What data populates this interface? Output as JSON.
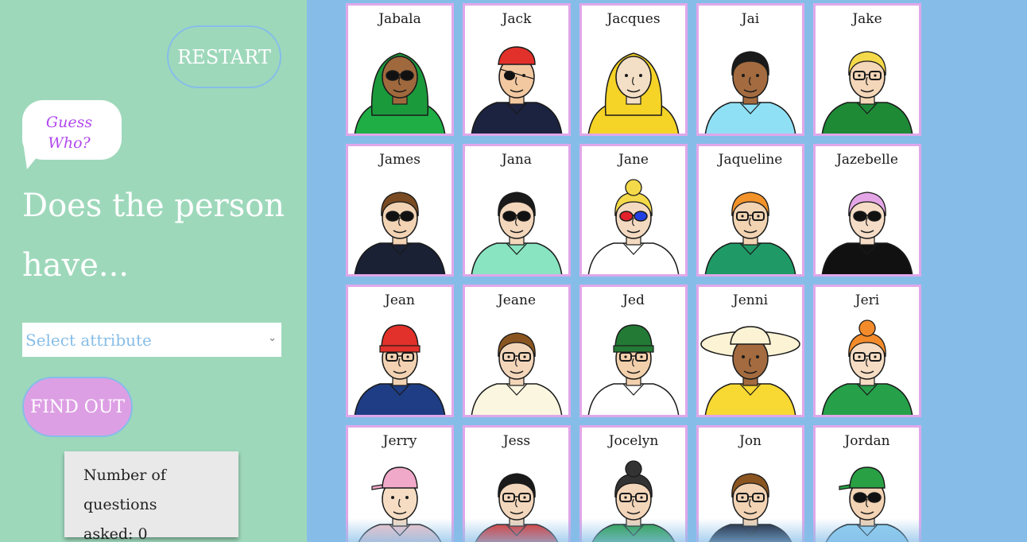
{
  "sidebar": {
    "restart_label": "RESTART",
    "bubble_line1": "Guess",
    "bubble_line2": "Who?",
    "question_line1": "Does the person",
    "question_line2": "have...",
    "select_placeholder": "Select attribute",
    "find_out_label": "FIND OUT",
    "counter_line1": "Number of questions",
    "counter_line2": "asked: 0"
  },
  "colors": {
    "sidebar_bg": "#9ed8bb",
    "board_bg": "#86bde8",
    "card_border": "#e0a7ea",
    "find_out_bg": "#dd9fe4",
    "bubble_text": "#b249f0"
  },
  "cards": [
    {
      "name": "Jabala",
      "skin": "#a0693d",
      "hair": "#1b9a3c",
      "headwear": "hijab",
      "top": "#1eae45",
      "glasses": "sun",
      "hat": "none"
    },
    {
      "name": "Jack",
      "skin": "#f2c8a0",
      "hair": "#a0622b",
      "headwear": "bandana",
      "top": "#1c2340",
      "glasses": "patch",
      "hat": "#e2312a"
    },
    {
      "name": "Jacques",
      "skin": "#f3dfc5",
      "hair": "#dcdcdc",
      "headwear": "hood",
      "top": "#f5d327",
      "glasses": "none",
      "hat": "#f5d327"
    },
    {
      "name": "Jai",
      "skin": "#a36b3f",
      "hair": "#1a1a1a",
      "headwear": "none",
      "top": "#8fe0f5",
      "glasses": "none",
      "hat": "none"
    },
    {
      "name": "Jake",
      "skin": "#f4d6b8",
      "hair": "#f4d94a",
      "headwear": "none",
      "top": "#1e8a36",
      "glasses": "clear",
      "hat": "none"
    },
    {
      "name": "James",
      "skin": "#f2d3b4",
      "hair": "#7a4b22",
      "headwear": "none",
      "top": "#1b2135",
      "glasses": "sun",
      "hat": "none"
    },
    {
      "name": "Jana",
      "skin": "#f3d7bc",
      "hair": "#1a1a1a",
      "headwear": "none",
      "top": "#88e4c1",
      "glasses": "sun",
      "hat": "none"
    },
    {
      "name": "Jane",
      "skin": "#f3d9c0",
      "hair": "#f4da4a",
      "headwear": "bun",
      "top": "#ffffff",
      "glasses": "3d",
      "hat": "none"
    },
    {
      "name": "Jaqueline",
      "skin": "#f2d3b2",
      "hair": "#f2922a",
      "headwear": "none",
      "top": "#1f9a66",
      "glasses": "clear",
      "hat": "none"
    },
    {
      "name": "Jazebelle",
      "skin": "#f5dcc6",
      "hair": "#e4a6e6",
      "headwear": "none",
      "top": "#111111",
      "glasses": "sun",
      "hat": "none"
    },
    {
      "name": "Jean",
      "skin": "#f2d2b2",
      "hair": "#c58a4a",
      "headwear": "beanie",
      "top": "#1e3d84",
      "glasses": "clear",
      "hat": "#e2312a"
    },
    {
      "name": "Jeane",
      "skin": "#f3d6ba",
      "hair": "#8a5520",
      "headwear": "none",
      "top": "#fbf6e0",
      "glasses": "clear",
      "hat": "none"
    },
    {
      "name": "Jed",
      "skin": "#f2d0ac",
      "hair": "#e9862a",
      "headwear": "beanie",
      "top": "#ffffff",
      "glasses": "clear",
      "hat": "#237a35"
    },
    {
      "name": "Jenni",
      "skin": "#a36b3f",
      "hair": "#1a1a1a",
      "headwear": "sunhat",
      "top": "#f8d832",
      "glasses": "none",
      "hat": "#fbf3d4"
    },
    {
      "name": "Jeri",
      "skin": "#f5dcc3",
      "hair": "#f38b2a",
      "headwear": "bun",
      "top": "#27a04a",
      "glasses": "clear",
      "hat": "none"
    },
    {
      "name": "Jerry",
      "skin": "#f5dcc3",
      "hair": "#f5dcc3",
      "headwear": "cap",
      "top": "#f6c6c8",
      "glasses": "none",
      "hat": "#f0a9c9"
    },
    {
      "name": "Jess",
      "skin": "#f3d7bc",
      "hair": "#1a1a1a",
      "headwear": "none",
      "top": "#e2312a",
      "glasses": "clear",
      "hat": "none"
    },
    {
      "name": "Jocelyn",
      "skin": "#f3d6ba",
      "hair": "#333333",
      "headwear": "bun",
      "top": "#2aa045",
      "glasses": "clear",
      "hat": "none"
    },
    {
      "name": "Jon",
      "skin": "#f2d3b4",
      "hair": "#8a5520",
      "headwear": "none",
      "top": "#1b2135",
      "glasses": "clear",
      "hat": "none"
    },
    {
      "name": "Jordan",
      "skin": "#f2d3b4",
      "hair": "#f4d94a",
      "headwear": "cap",
      "top": "#8fd0f0",
      "glasses": "sun",
      "hat": "#2aa045"
    }
  ]
}
